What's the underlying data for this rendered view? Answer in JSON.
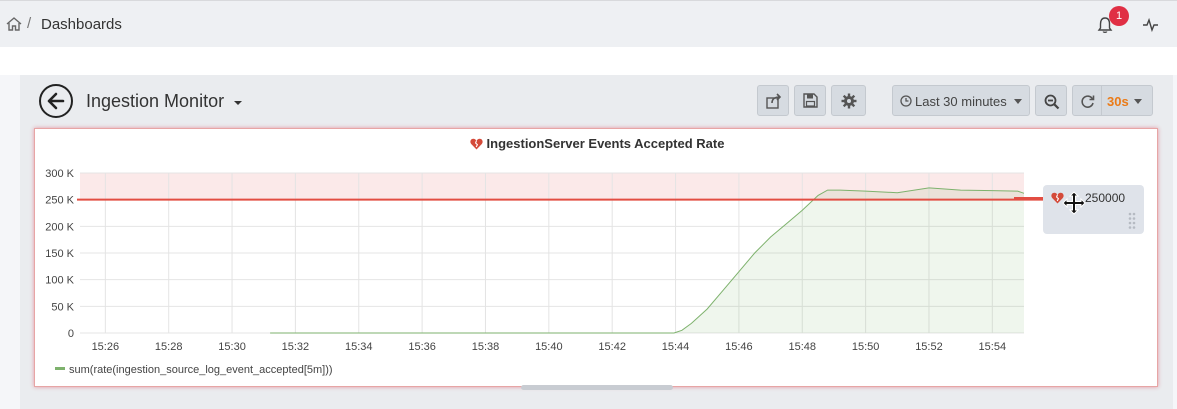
{
  "topbar": {
    "breadcrumb_sep": "/",
    "breadcrumb": "Dashboards",
    "alert_count": "1",
    "icons": [
      "home-icon",
      "bell-icon",
      "activity-icon"
    ]
  },
  "dashboard": {
    "title": "Ingestion Monitor",
    "toolbar": {
      "share_icon": "share-icon",
      "save_icon": "save-icon",
      "settings_icon": "gear-icon",
      "time_range": "Last 30 minutes",
      "zoom_icon": "zoom-out-icon",
      "refresh_interval": "30s"
    }
  },
  "panel": {
    "title": "IngestionServer Events Accepted Rate",
    "alert_state": "alerting",
    "legend": "sum(rate(ingestion_source_log_event_accepted[5m]))",
    "threshold_label": "250000",
    "colors": {
      "series": "#7eb26d",
      "threshold": "#e24d42",
      "critical_fill": "#fbe9e9"
    }
  },
  "chart_data": {
    "type": "area",
    "title": "IngestionServer Events Accepted Rate",
    "xlabel": "",
    "ylabel": "",
    "x_ticks": [
      "15:26",
      "15:28",
      "15:30",
      "15:32",
      "15:34",
      "15:36",
      "15:38",
      "15:40",
      "15:42",
      "15:44",
      "15:46",
      "15:48",
      "15:50",
      "15:52",
      "15:54"
    ],
    "y_ticks": [
      "0",
      "50 K",
      "100 K",
      "150 K",
      "200 K",
      "250 K",
      "300 K"
    ],
    "ylim": [
      0,
      300000
    ],
    "xlim_minutes": [
      25.2,
      55.0
    ],
    "threshold": 250000,
    "grid": true,
    "legend_position": "bottom-left",
    "series": [
      {
        "name": "sum(rate(ingestion_source_log_event_accepted[5m]))",
        "x_minutes": [
          31.2,
          32,
          34,
          36,
          38,
          40,
          42,
          43.95,
          44.2,
          44.5,
          45,
          45.5,
          46,
          46.5,
          47,
          47.5,
          48,
          48.5,
          48.8,
          49.2,
          50,
          51,
          52,
          53,
          54,
          54.8,
          55.0
        ],
        "values": [
          0,
          0,
          0,
          0,
          0,
          0,
          0,
          0,
          5000,
          18000,
          45000,
          80000,
          115000,
          150000,
          180000,
          205000,
          230000,
          258000,
          268000,
          268000,
          266000,
          263000,
          272000,
          268000,
          267000,
          266000,
          262000
        ]
      }
    ]
  }
}
